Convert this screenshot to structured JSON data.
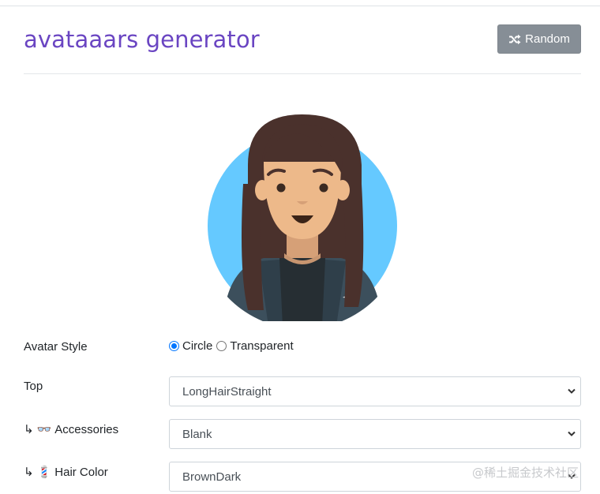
{
  "header": {
    "title": "avataaars generator",
    "random_label": "Random"
  },
  "avatar": {
    "background_color": "#65c9ff",
    "skin_color": "#edb98a",
    "hair_color": "#4a312c",
    "clothes_color": "#3c4f5c"
  },
  "form": {
    "avatar_style": {
      "label": "Avatar Style",
      "options": [
        "Circle",
        "Transparent"
      ],
      "selected": "Circle"
    },
    "top": {
      "label": "Top",
      "value": "LongHairStraight"
    },
    "accessories": {
      "arrow": "↳",
      "emoji": "👓",
      "label": "Accessories",
      "value": "Blank"
    },
    "hair_color": {
      "arrow": "↳",
      "emoji": "💈",
      "label": "Hair Color",
      "value": "BrownDark"
    }
  },
  "watermark": "@稀土掘金技术社区"
}
